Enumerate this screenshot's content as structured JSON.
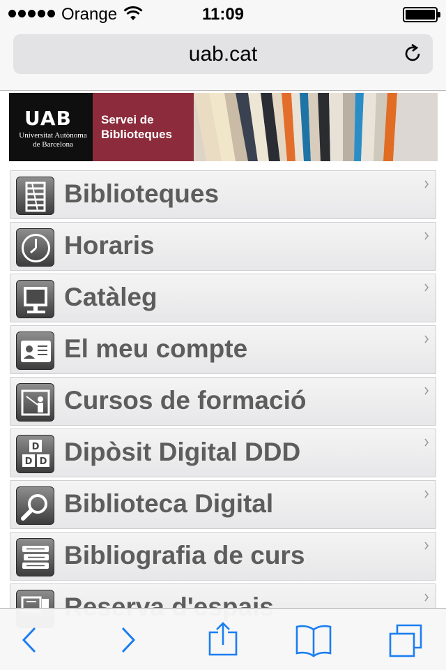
{
  "status_bar": {
    "carrier": "Orange",
    "time": "11:09"
  },
  "address_bar": {
    "url": "uab.cat"
  },
  "banner": {
    "logo_text": "UAB",
    "university": "Universitat Autònoma de Barcelona",
    "service_line1": "Servei de",
    "service_line2": "Biblioteques"
  },
  "menu": {
    "items": [
      {
        "label": "Biblioteques",
        "icon": "library-shelf-icon"
      },
      {
        "label": "Horaris",
        "icon": "clock-icon"
      },
      {
        "label": "Catàleg",
        "icon": "computer-monitor-icon"
      },
      {
        "label": "El meu compte",
        "icon": "id-card-icon"
      },
      {
        "label": "Cursos de formació",
        "icon": "teacher-board-icon"
      },
      {
        "label": "Dipòsit Digital DDD",
        "icon": "blocks-icon"
      },
      {
        "label": "Biblioteca Digital",
        "icon": "magnifier-icon"
      },
      {
        "label": "Bibliografia de curs",
        "icon": "book-stack-icon"
      },
      {
        "label": "Reserva d'espais",
        "icon": "room-reservation-icon"
      }
    ]
  },
  "toolbar": {
    "buttons": [
      "back-icon",
      "forward-icon",
      "share-icon",
      "bookmarks-icon",
      "tabs-icon"
    ],
    "accent": "#1a7ef2"
  }
}
